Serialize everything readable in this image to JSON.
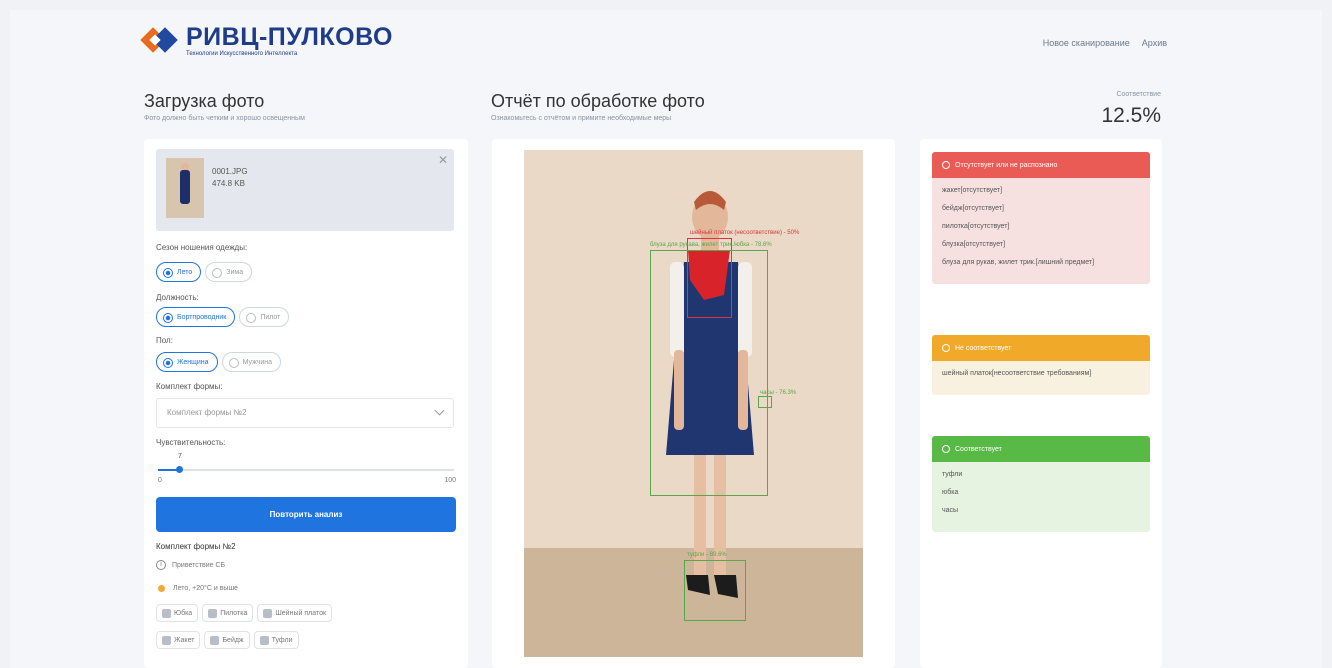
{
  "header": {
    "logo_title": "РИВЦ-ПУЛКОВО",
    "logo_subtitle": "Технологии Искусственного Интеллекта",
    "nav": [
      "Новое сканирование",
      "Архив"
    ]
  },
  "upload": {
    "title": "Загрузка фото",
    "subtitle": "Фото должно быть четким и хорошо освещенным",
    "file": {
      "name": "0001.JPG",
      "size": "474.8 KB"
    },
    "season_label": "Сезон ношения одежды:",
    "season_options": [
      "Лето",
      "Зима"
    ],
    "position_label": "Должность:",
    "position_options": [
      "Бортпроводник",
      "Пилот"
    ],
    "gender_label": "Пол:",
    "gender_options": [
      "Женщина",
      "Мужчина"
    ],
    "kit_label": "Комплект формы:",
    "kit_select": "Комплект формы №2",
    "sensitivity_label": "Чувствительность:",
    "sensitivity_value": "7",
    "sensitivity_min": "0",
    "sensitivity_max": "100",
    "sensitivity_fraction": 0.07,
    "repeat_button": "Повторить анализ",
    "kit_title": "Комплект формы №2",
    "kit_info": "Приветствие СБ",
    "kit_season": "Лето, +20°C и выше",
    "kit_items_row1": [
      "Юбка",
      "Пилотка",
      "Шейный платок"
    ],
    "kit_items_row2": [
      "Жакет",
      "Бейдж",
      "Туфли"
    ]
  },
  "report": {
    "title": "Отчёт по обработке фото",
    "subtitle": "Ознакомьтесь с отчётом и примите необходимые меры",
    "detections": [
      {
        "label": "шейный платок (несоответствие) - 50%",
        "color": "#d9363e"
      },
      {
        "label": "блуза для рукава, жилет трик./юбка - 78.6%",
        "color": "#5aa64a"
      },
      {
        "label": "часы - 76.3%",
        "color": "#5aa64a"
      },
      {
        "label": "туфли - 89.6%",
        "color": "#5aa64a"
      }
    ]
  },
  "match": {
    "label": "Соответствие",
    "value": "12.5%"
  },
  "results": {
    "missing": {
      "title": "Отсутствует или не распознано",
      "color": "#ea5b55",
      "items": [
        "жакет[отсутствует]",
        "бейдж[отсутствует]",
        "пилотка[отсутствует]",
        "блузка[отсутствует]",
        "блуза для рукав, жилет трик.[лишний предмет]"
      ]
    },
    "mismatch": {
      "title": "Не соответствует",
      "color": "#f0a928",
      "items": [
        "шейный платок[несоответствие требованиям]"
      ]
    },
    "match": {
      "title": "Соответствует",
      "color": "#58b947",
      "items": [
        "туфли",
        "юбка",
        "часы"
      ]
    }
  }
}
